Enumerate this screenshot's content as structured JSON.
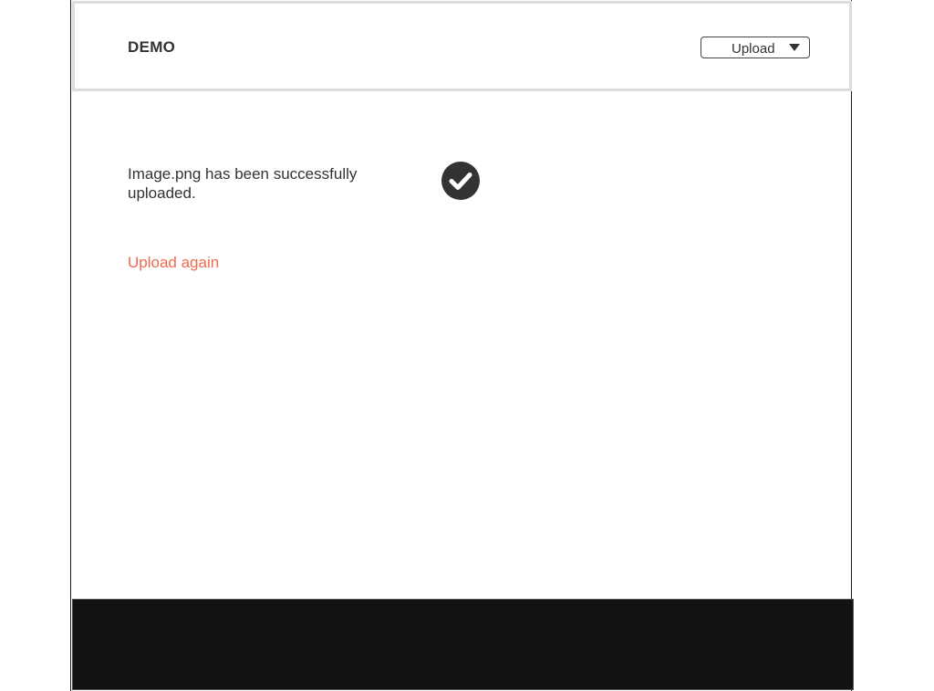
{
  "header": {
    "brand": "DEMO",
    "upload_select": {
      "selected": "Upload"
    }
  },
  "main": {
    "message": "Image.png has been successfully uploaded.",
    "status_icon": "check-circle-icon",
    "upload_again_label": "Upload again"
  },
  "colors": {
    "accent_link": "#f06a4f",
    "text": "#333333",
    "footer_bg": "#121212",
    "header_border": "#dcdcdc"
  }
}
